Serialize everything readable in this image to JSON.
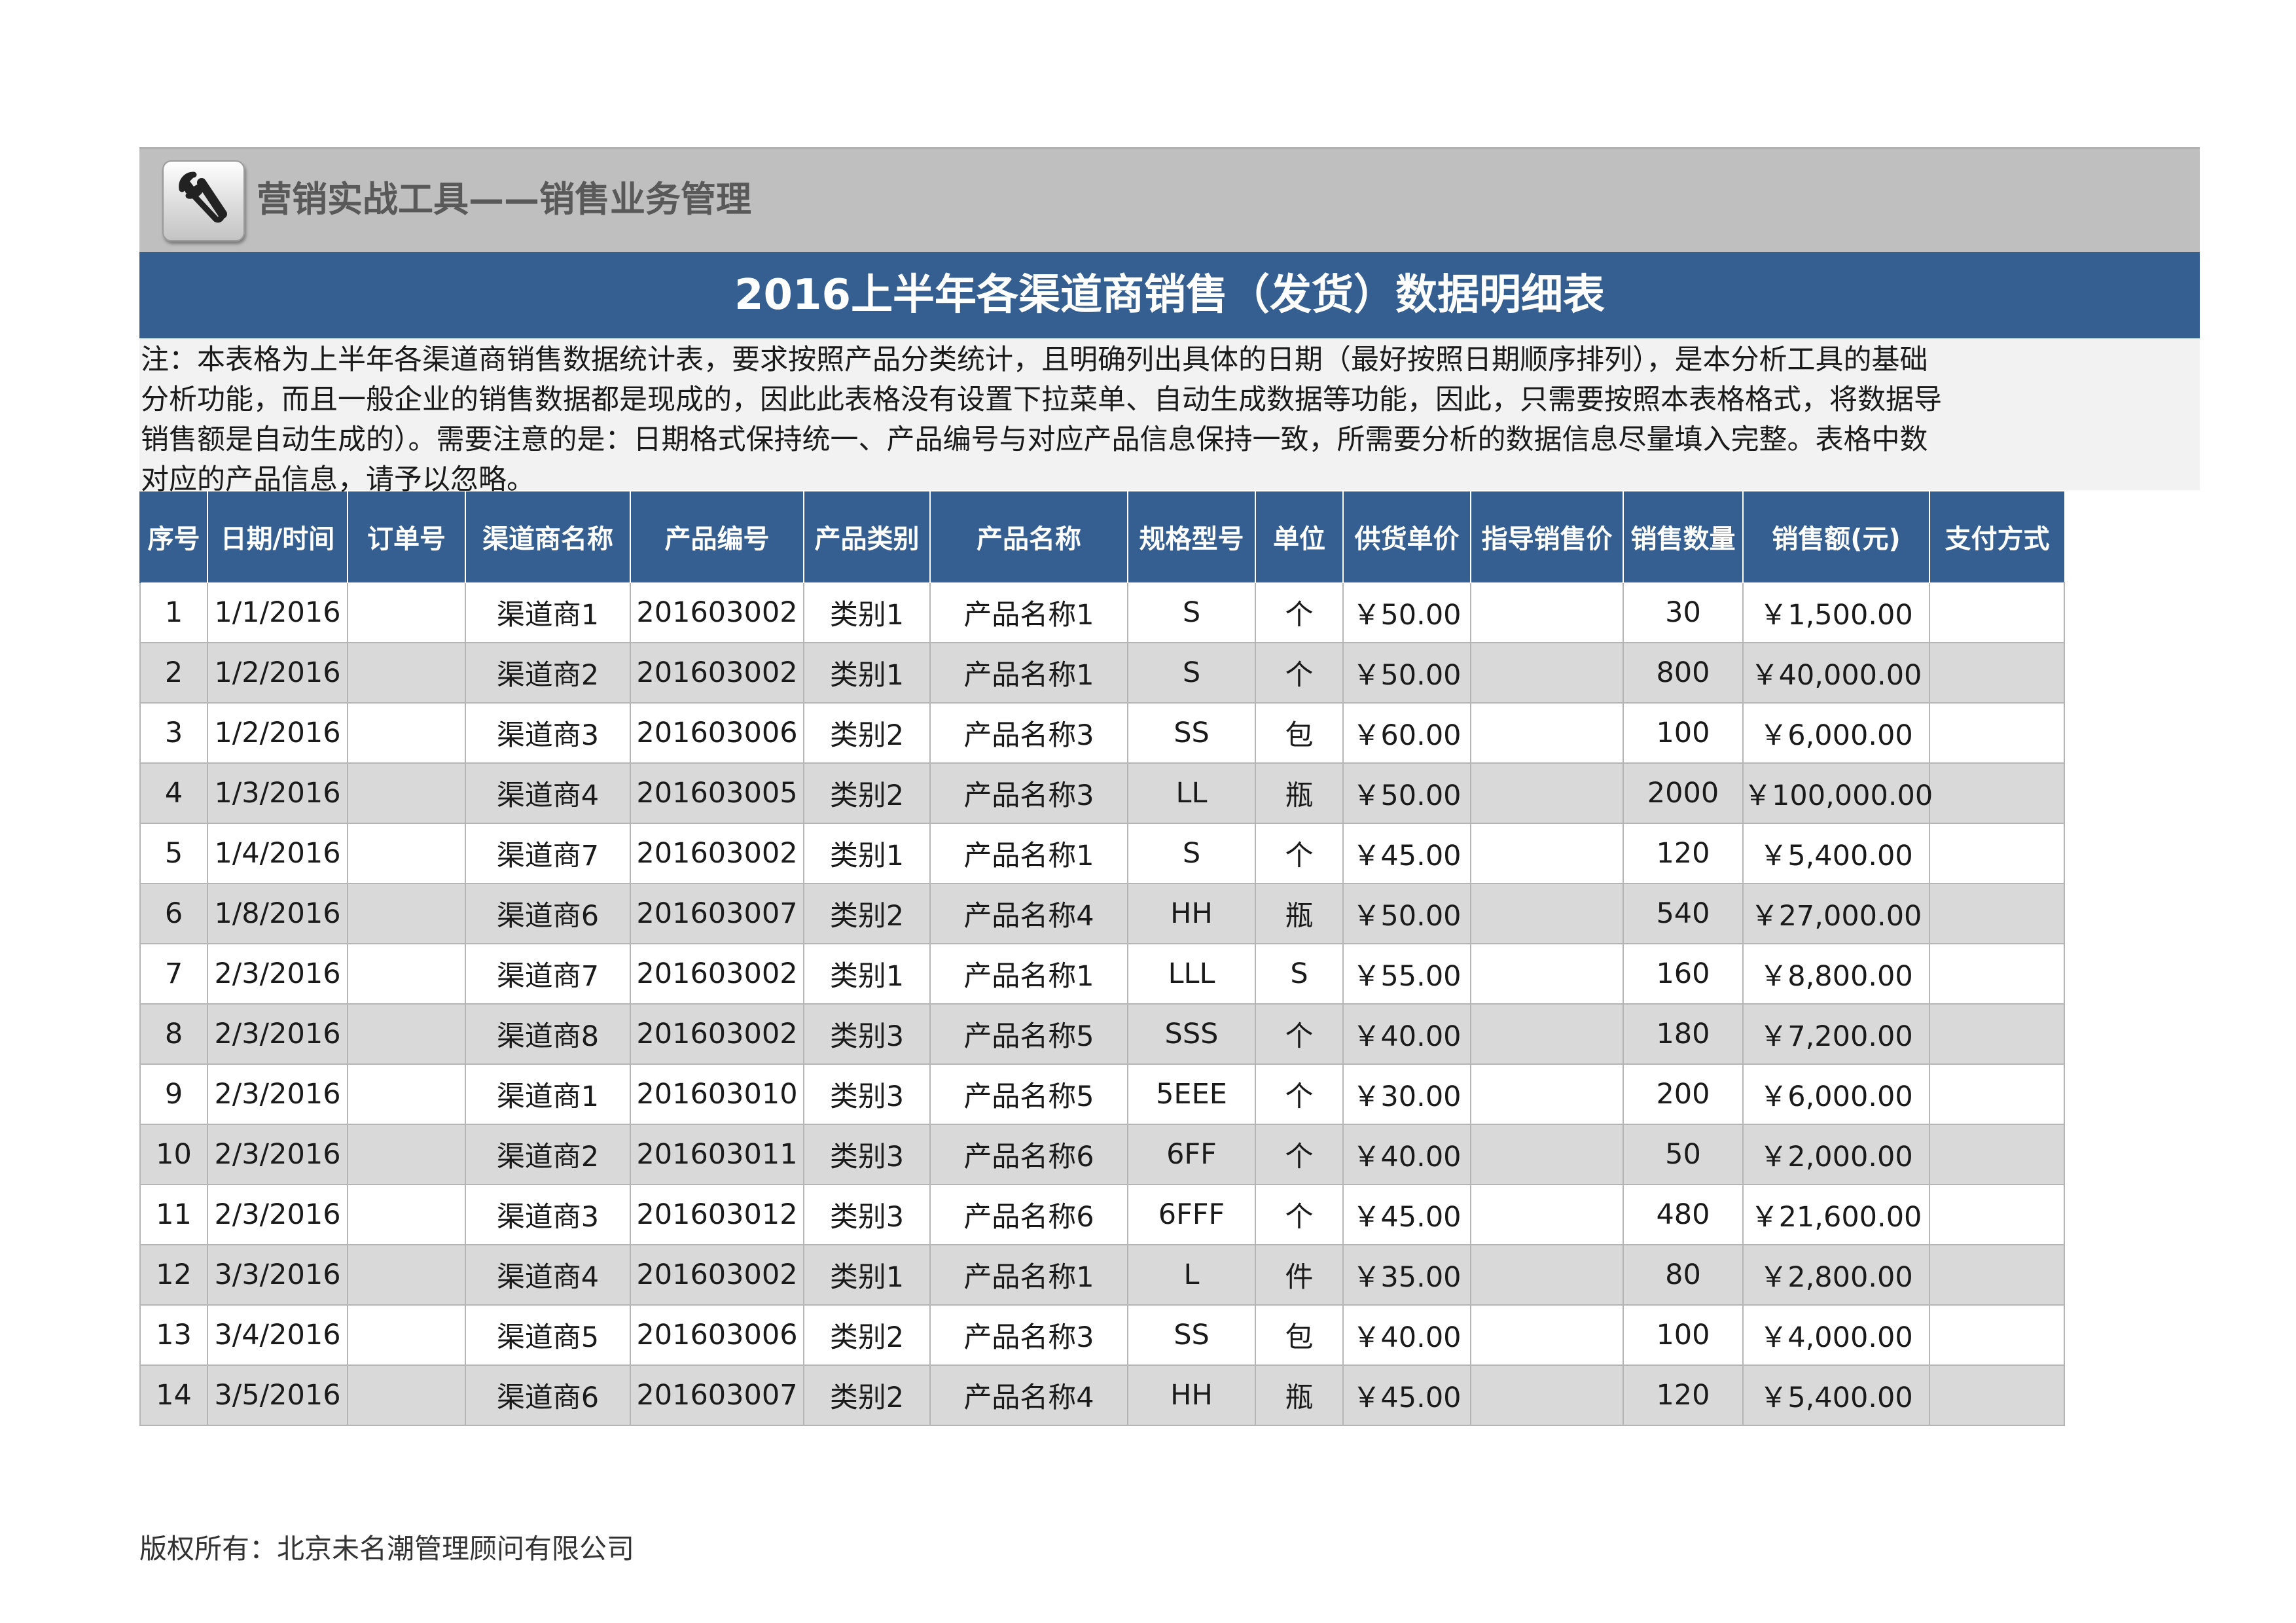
{
  "app_title": "营销实战工具——销售业务管理",
  "page_title": "2016上半年各渠道商销售（发货）数据明细表",
  "note_lines": [
    "注：本表格为上半年各渠道商销售数据统计表，要求按照产品分类统计，且明确列出具体的日期（最好按照日期顺序排列），是本分析工具的基础",
    "分析功能，而且一般企业的销售数据都是现成的，因此此表格没有设置下拉菜单、自动生成数据等功能，因此，只需要按照本表格格式，将数据导",
    "销售额是自动生成的）。需要注意的是：日期格式保持统一、产品编号与对应产品信息保持一致，所需要分析的数据信息尽量填入完整。表格中数",
    "对应的产品信息，请予以忽略。"
  ],
  "columns": [
    "序号",
    "日期/时间",
    "订单号",
    "渠道商名称",
    "产品编号",
    "产品类别",
    "产品名称",
    "规格型号",
    "单位",
    "供货单价",
    "指导销售价",
    "销售数量",
    "销售额(元)",
    "支付方式"
  ],
  "rows": [
    [
      "1",
      "1/1/2016",
      "",
      "渠道商1",
      "201603002",
      "类别1",
      "产品名称1",
      "S",
      "个",
      "￥50.00",
      "",
      "30",
      "￥1,500.00",
      ""
    ],
    [
      "2",
      "1/2/2016",
      "",
      "渠道商2",
      "201603002",
      "类别1",
      "产品名称1",
      "S",
      "个",
      "￥50.00",
      "",
      "800",
      "￥40,000.00",
      ""
    ],
    [
      "3",
      "1/2/2016",
      "",
      "渠道商3",
      "201603006",
      "类别2",
      "产品名称3",
      "SS",
      "包",
      "￥60.00",
      "",
      "100",
      "￥6,000.00",
      ""
    ],
    [
      "4",
      "1/3/2016",
      "",
      "渠道商4",
      "201603005",
      "类别2",
      "产品名称3",
      "LL",
      "瓶",
      "￥50.00",
      "",
      "2000",
      "￥100,000.00",
      ""
    ],
    [
      "5",
      "1/4/2016",
      "",
      "渠道商7",
      "201603002",
      "类别1",
      "产品名称1",
      "S",
      "个",
      "￥45.00",
      "",
      "120",
      "￥5,400.00",
      ""
    ],
    [
      "6",
      "1/8/2016",
      "",
      "渠道商6",
      "201603007",
      "类别2",
      "产品名称4",
      "HH",
      "瓶",
      "￥50.00",
      "",
      "540",
      "￥27,000.00",
      ""
    ],
    [
      "7",
      "2/3/2016",
      "",
      "渠道商7",
      "201603002",
      "类别1",
      "产品名称1",
      "LLL",
      "S",
      "￥55.00",
      "",
      "160",
      "￥8,800.00",
      ""
    ],
    [
      "8",
      "2/3/2016",
      "",
      "渠道商8",
      "201603002",
      "类别3",
      "产品名称5",
      "SSS",
      "个",
      "￥40.00",
      "",
      "180",
      "￥7,200.00",
      ""
    ],
    [
      "9",
      "2/3/2016",
      "",
      "渠道商1",
      "201603010",
      "类别3",
      "产品名称5",
      "5EEE",
      "个",
      "￥30.00",
      "",
      "200",
      "￥6,000.00",
      ""
    ],
    [
      "10",
      "2/3/2016",
      "",
      "渠道商2",
      "201603011",
      "类别3",
      "产品名称6",
      "6FF",
      "个",
      "￥40.00",
      "",
      "50",
      "￥2,000.00",
      ""
    ],
    [
      "11",
      "2/3/2016",
      "",
      "渠道商3",
      "201603012",
      "类别3",
      "产品名称6",
      "6FFF",
      "个",
      "￥45.00",
      "",
      "480",
      "￥21,600.00",
      ""
    ],
    [
      "12",
      "3/3/2016",
      "",
      "渠道商4",
      "201603002",
      "类别1",
      "产品名称1",
      "L",
      "件",
      "￥35.00",
      "",
      "80",
      "￥2,800.00",
      ""
    ],
    [
      "13",
      "3/4/2016",
      "",
      "渠道商5",
      "201603006",
      "类别2",
      "产品名称3",
      "SS",
      "包",
      "￥40.00",
      "",
      "100",
      "￥4,000.00",
      ""
    ],
    [
      "14",
      "3/5/2016",
      "",
      "渠道商6",
      "201603007",
      "类别2",
      "产品名称4",
      "HH",
      "瓶",
      "￥45.00",
      "",
      "120",
      "￥5,400.00",
      ""
    ]
  ],
  "footer": "版权所有：北京未名潮管理顾问有限公司",
  "colors": {
    "header_blue": "#365f91",
    "banner_gray": "#bfbfbf",
    "stripe_gray": "#d9d9d9"
  },
  "icons": {
    "logo": "wrench-icon"
  }
}
